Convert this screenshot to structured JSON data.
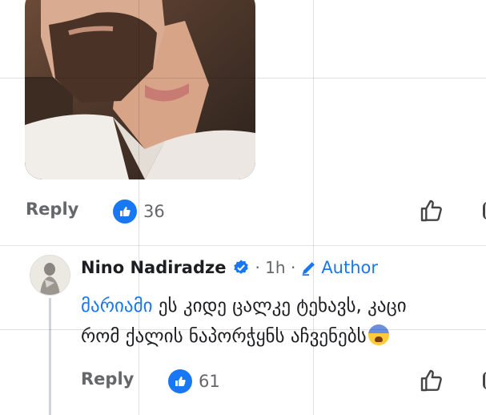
{
  "post_comment_1": {
    "reply_label": "Reply",
    "reaction_count": "36"
  },
  "comment_2": {
    "author": "Nino Nadiradze",
    "time": "· 1h ·",
    "author_badge": "Author",
    "mention": "მარიამი",
    "text_line1": " ეს კიდე ცალკე ტეხავს, კაცი",
    "text_line2": "რომ ქალის ნაპორჭყნს აჩვენებს",
    "reply_label": "Reply",
    "reaction_count": "61"
  },
  "colors": {
    "accent": "#1877f2",
    "muted": "#65676b",
    "text": "#1c1e21"
  },
  "icons": [
    "like-badge-icon",
    "thumbs-up-outline-icon",
    "verified-icon",
    "pencil-icon",
    "fearful-face-emoji"
  ]
}
